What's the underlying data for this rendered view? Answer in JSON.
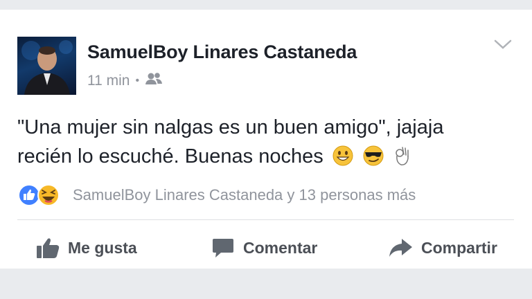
{
  "post": {
    "author": "SamuelBoy Linares Castaneda",
    "time": "11 min",
    "separator": "•",
    "audience_icon": "friends-icon",
    "menu_icon": "chevron-down-icon",
    "text_line1": "\"Una mujer sin nalgas es un buen amigo\", jajaja",
    "text_line2": "recién lo escuché. Buenas noches",
    "emojis": [
      "grinning-face-emoji",
      "sunglasses-face-emoji",
      "ok-hand-emoji"
    ]
  },
  "reactions": {
    "icons": [
      "like-reaction-icon",
      "haha-reaction-icon"
    ],
    "summary": "SamuelBoy Linares Castaneda y 13 personas más"
  },
  "actions": {
    "like_label": "Me gusta",
    "comment_label": "Comentar",
    "share_label": "Compartir"
  },
  "colors": {
    "like_blue": "#4080ff",
    "haha_yellow": "#f7b928",
    "text_dark": "#1d2129",
    "text_grey": "#90949c",
    "action_grey": "#4b4f56"
  }
}
